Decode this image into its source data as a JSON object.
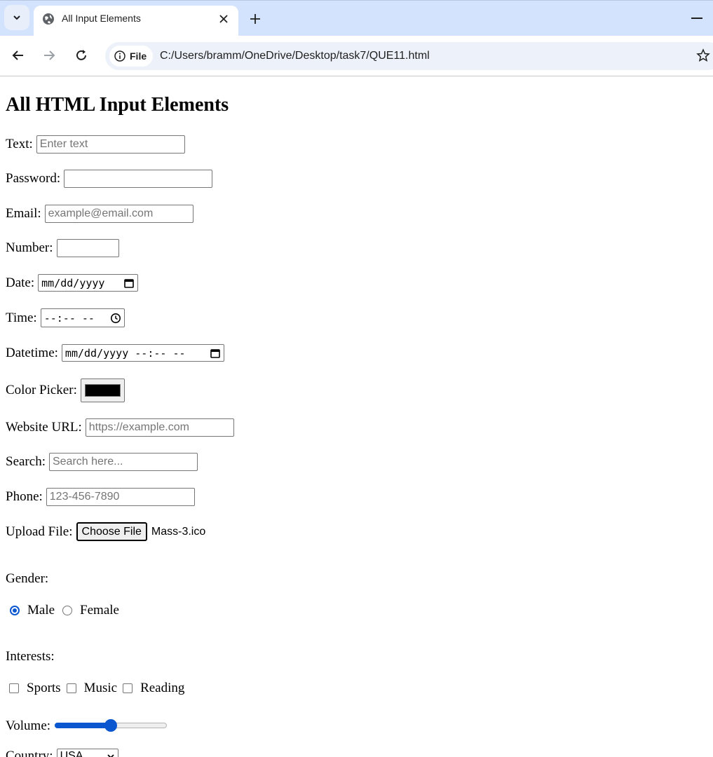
{
  "browser": {
    "tab_title": "All Input Elements",
    "site_chip": "File",
    "url": "C:/Users/bramm/OneDrive/Desktop/task7/QUE11.html"
  },
  "page": {
    "heading": "All HTML Input Elements",
    "text": {
      "label": "Text:",
      "placeholder": "Enter text"
    },
    "password": {
      "label": "Password:"
    },
    "email": {
      "label": "Email:",
      "placeholder": "example@email.com"
    },
    "number": {
      "label": "Number:"
    },
    "date": {
      "label": "Date:",
      "placeholder": "mm/dd/yyyy"
    },
    "time": {
      "label": "Time:",
      "placeholder": "--:-- --"
    },
    "datetime": {
      "label": "Datetime:",
      "placeholder": "mm/dd/yyyy --:-- --"
    },
    "color": {
      "label": "Color Picker:",
      "value": "#000000"
    },
    "url": {
      "label": "Website URL:",
      "placeholder": "https://example.com"
    },
    "search": {
      "label": "Search:",
      "placeholder": "Search here..."
    },
    "phone": {
      "label": "Phone:",
      "placeholder": "123-456-7890"
    },
    "file": {
      "label": "Upload File:",
      "button": "Choose File",
      "filename": "Mass-3.ico"
    },
    "gender": {
      "label": "Gender:",
      "options": [
        "Male",
        "Female"
      ],
      "selected": "Male"
    },
    "interests": {
      "label": "Interests:",
      "options": [
        "Sports",
        "Music",
        "Reading"
      ],
      "checked": []
    },
    "volume": {
      "label": "Volume:",
      "value_fraction": 0.5
    },
    "country": {
      "label": "Country:",
      "selected": "USA"
    }
  },
  "colors": {
    "accent": "#0b57d0",
    "chrome_bg": "#d3e3fd"
  }
}
